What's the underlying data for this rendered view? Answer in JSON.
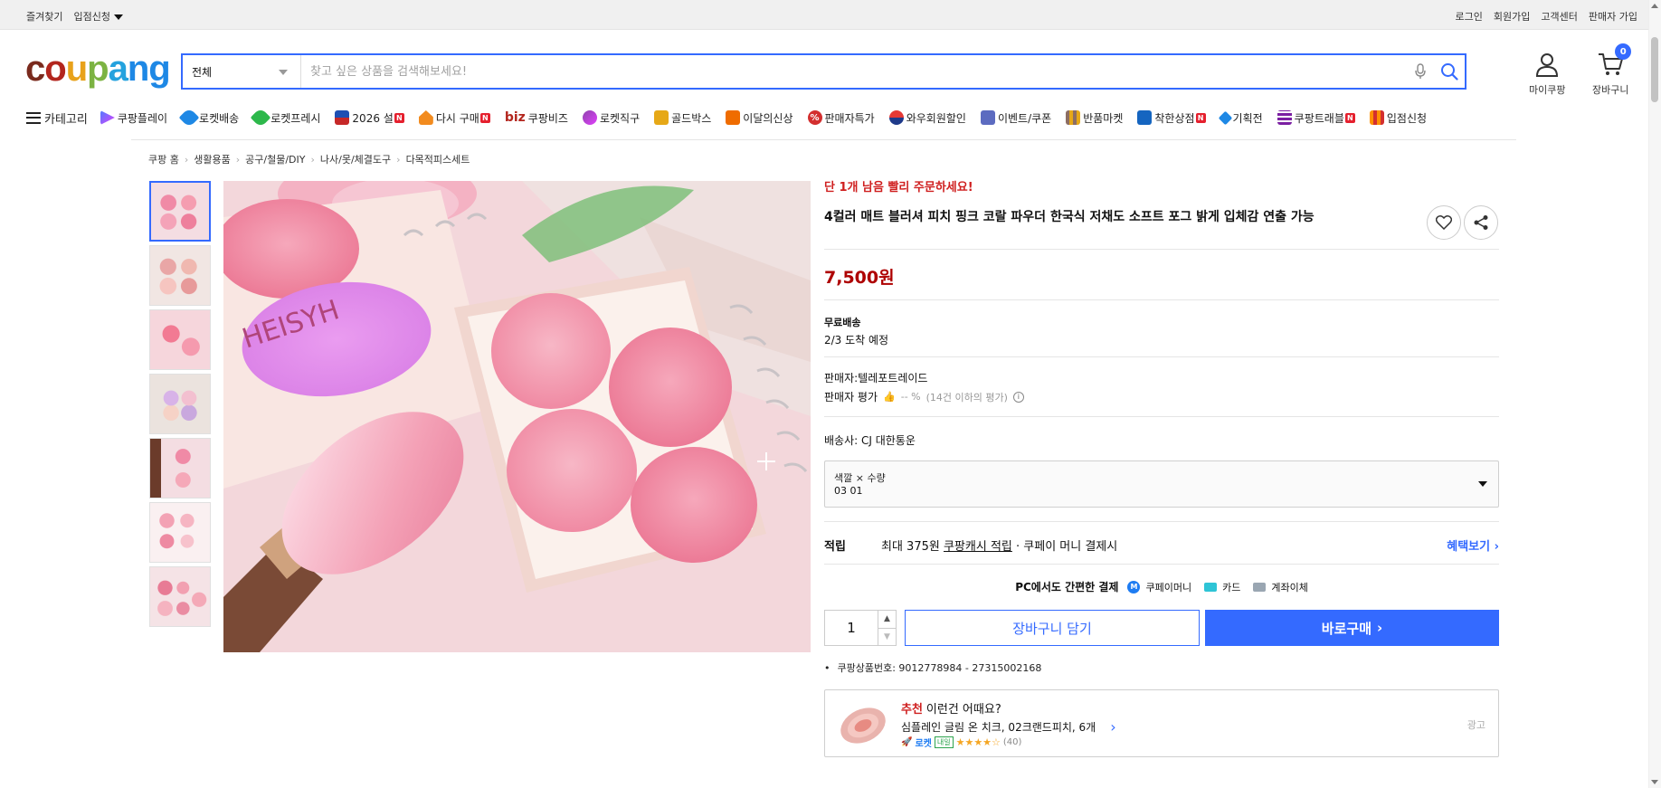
{
  "topbar": {
    "left": [
      "즐겨찾기",
      "입점신청"
    ],
    "right": [
      "로그인",
      "회원가입",
      "고객센터",
      "판매자 가입"
    ]
  },
  "search": {
    "category": "전체",
    "placeholder": "찾고 싶은 상품을 검색해보세요!"
  },
  "header": {
    "mypage_label": "마이쿠팡",
    "cart_label": "장바구니",
    "cart_count": "0"
  },
  "nav": {
    "category_label": "카테고리",
    "items": [
      {
        "label": "쿠팡플레이",
        "color": "#4f7cff"
      },
      {
        "label": "로켓배송",
        "color": "#1e88e5"
      },
      {
        "label": "로켓프레시",
        "color": "#2db84b"
      },
      {
        "label": "2026 설",
        "color": "#c62828"
      },
      {
        "label": "다시 구매",
        "color": "#f28b1e"
      },
      {
        "label": "쿠팡비즈",
        "prefix": "biz",
        "color": "#b3261e"
      },
      {
        "label": "로켓직구",
        "color": "#8e44ad"
      },
      {
        "label": "골드박스",
        "color": "#e6a817"
      },
      {
        "label": "이달의신상",
        "color": "#ef6c00"
      },
      {
        "label": "판매자특가",
        "color": "#d32f2f"
      },
      {
        "label": "와우회원할인",
        "color": "#e53935"
      },
      {
        "label": "이벤트/쿠폰",
        "color": "#5c6bc0"
      },
      {
        "label": "반품마켓",
        "color": "#8d6e63"
      },
      {
        "label": "착한상점",
        "color": "#1565c0"
      },
      {
        "label": "기획전",
        "color": "#1e88e5"
      },
      {
        "label": "쿠팡트래블",
        "color": "#7b1fa2"
      },
      {
        "label": "입점신청",
        "color": "#ff8f00"
      }
    ]
  },
  "breadcrumb": [
    "쿠팡 홈",
    "생활용품",
    "공구/철물/DIY",
    "나사/못/체결도구",
    "다목적피스세트"
  ],
  "product": {
    "urgent": "단 1개 남음 빨리 주문하세요!",
    "title": "4컬러 매트 블러셔 피치 핑크 코랄 파우더 한국식 저채도 소프트 포그 밝게 입체감 연출 가능",
    "price": "7,500원",
    "shipping_label": "무료배송",
    "shipping_eta": "2/3 도착 예정",
    "seller": "판매자:텔레포트레이드",
    "seller_rating_label": "판매자 평가",
    "seller_rating_value": "-- %",
    "seller_rating_note": "(14건 이하의 평가)",
    "courier": "배송사:  CJ 대한통운",
    "option_label": "색깔 × 수량",
    "option_value": "03 01",
    "reward_label": "적립",
    "reward_pre": "최대 375원",
    "reward_link": "쿠팡캐시 적립",
    "reward_post": "· 쿠페이 머니 결제시",
    "reward_more": "혜택보기",
    "pay_caption": "PC에서도 간편한 결제",
    "pay_methods": [
      "쿠페이머니",
      "카드",
      "계좌이체"
    ],
    "quantity": "1",
    "cart_button": "장바구니 담기",
    "buy_button": "바로구매",
    "product_no": "쿠팡상품번호: 9012778984 - 27315002168"
  },
  "recommend": {
    "highlight": "추천",
    "heading": "이런건 어때요?",
    "name": "심플레인 글림 온 치크, 02크랜드피치, 6개",
    "badge_rocket": "로켓",
    "badge_tomorrow": "내일",
    "rating": 4.5,
    "review_count": "(40)",
    "ad_label": "광고"
  },
  "colors": {
    "accent": "#346aff",
    "price": "#ae0000",
    "urgent": "#cf1f1f"
  }
}
